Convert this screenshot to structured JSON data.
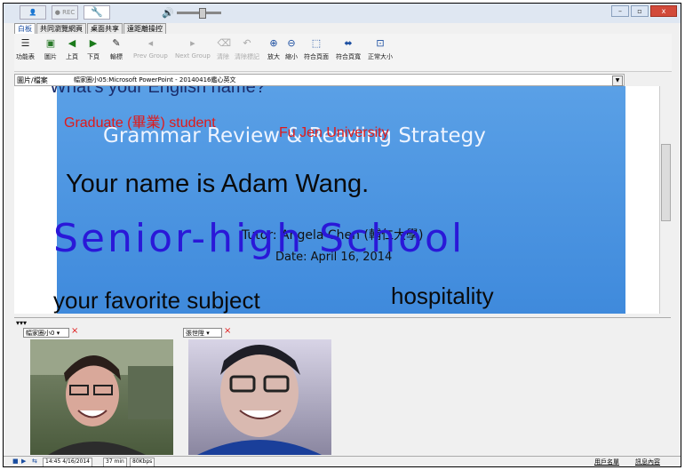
{
  "titlebar": {
    "rec_label": "REC",
    "minimize": "–",
    "restore": "▫",
    "close": "x"
  },
  "tabs": [
    "白板",
    "共同瀏覽網頁",
    "桌面共享",
    "遠距離操控"
  ],
  "toolbar": [
    {
      "icon": "menu-icon",
      "glyph": "☰",
      "label": "功能表"
    },
    {
      "icon": "image-icon",
      "glyph": "▣",
      "label": "圖片"
    },
    {
      "icon": "prev-page-icon",
      "glyph": "◀",
      "label": "上頁"
    },
    {
      "icon": "next-page-icon",
      "glyph": "▶",
      "label": "下頁"
    },
    {
      "icon": "tool-icon",
      "glyph": "✎",
      "label": "輸標"
    },
    {
      "icon": "prev-group-icon",
      "glyph": "◂",
      "label": "Prev Group"
    },
    {
      "icon": "next-group-icon",
      "glyph": "▸",
      "label": "Next Group"
    },
    {
      "icon": "clear-icon",
      "glyph": "⌫",
      "label": "清除"
    },
    {
      "icon": "clear-mark-icon",
      "glyph": "↶",
      "label": "清除標記"
    },
    {
      "icon": "zoom-in-icon",
      "glyph": "⊕",
      "label": "放大"
    },
    {
      "icon": "zoom-out-icon",
      "glyph": "⊖",
      "label": "縮小"
    },
    {
      "icon": "fit-page-icon",
      "glyph": "⬚",
      "label": "符合頁面"
    },
    {
      "icon": "fit-width-icon",
      "glyph": "⬌",
      "label": "符合頁寬"
    },
    {
      "icon": "actual-size-icon",
      "glyph": "⊡",
      "label": "正常大小"
    }
  ],
  "address": {
    "label": "圖片/檔案",
    "value": "幅家圈小05:Microsoft PowerPoint - 20140416鑑心英文"
  },
  "slide": {
    "top_cut_text": "What's your English name?",
    "title": "Grammar Review & Reading Strategy",
    "tutor": "Tutor: Angela Chen (輔仁大學)",
    "date": "Date: April 16, 2014"
  },
  "annotations": {
    "red1": "Graduate (畢業) student",
    "red2": "Fu Jen University",
    "black1": "Your name is Adam Wang.",
    "blue_hand": "Senior-high School",
    "black2": "your favorite subject",
    "black3": "hospitality"
  },
  "cams": [
    {
      "name": "幅家圈小0"
    },
    {
      "name": "張世陞"
    }
  ],
  "status": {
    "time": "14:45 4/16/2014",
    "duration": "37 min",
    "bitrate": "80Kbps",
    "users": "用戶名單",
    "content": "訊息內容"
  }
}
